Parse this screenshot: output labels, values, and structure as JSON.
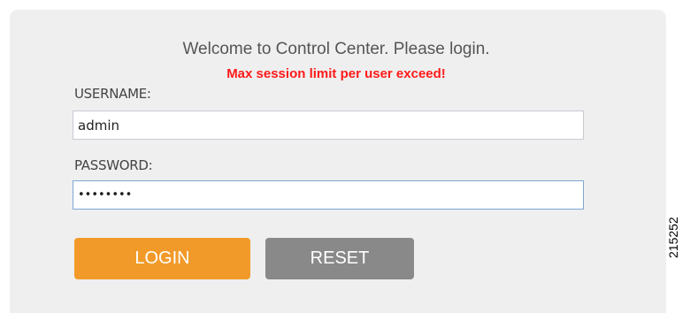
{
  "login": {
    "welcome_text": "Welcome to Control Center. Please login.",
    "error_text": "Max session limit per user exceed!",
    "username_label": "USERNAME:",
    "username_value": "admin",
    "password_label": "PASSWORD:",
    "password_value": "secretpw",
    "login_label": "LOGIN",
    "reset_label": "RESET"
  },
  "figure_id": "215252",
  "colors": {
    "panel_bg": "#efefef",
    "error_red": "#ff1a1a",
    "login_orange": "#f19a29",
    "reset_gray": "#898989",
    "password_focus_border": "#7fa6d3"
  }
}
